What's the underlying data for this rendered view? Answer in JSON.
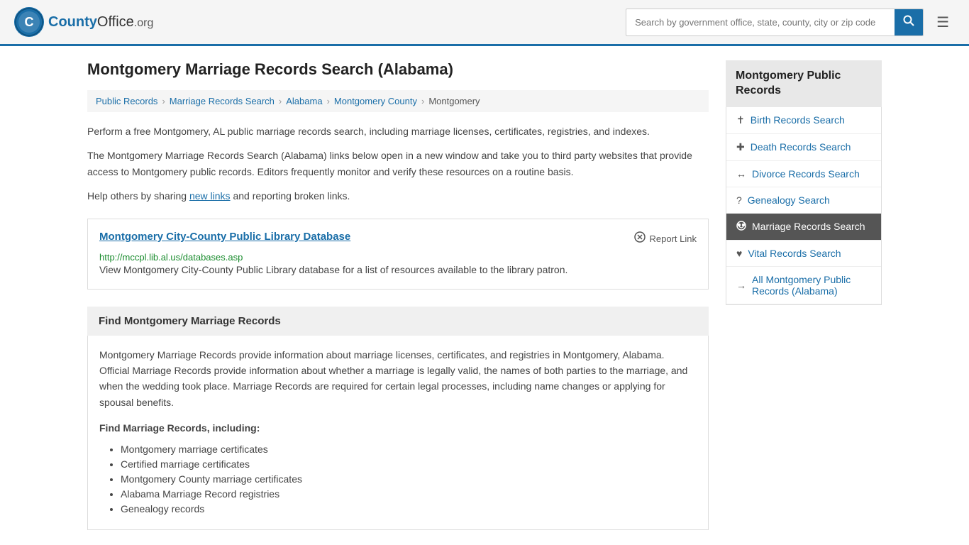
{
  "header": {
    "logo_text": "County",
    "logo_org": "Office",
    "logo_domain": ".org",
    "search_placeholder": "Search by government office, state, county, city or zip code",
    "menu_icon": "☰"
  },
  "page": {
    "title": "Montgomery Marriage Records Search (Alabama)",
    "breadcrumb": [
      {
        "label": "Public Records",
        "href": "#"
      },
      {
        "label": "Marriage Records Search",
        "href": "#"
      },
      {
        "label": "Alabama",
        "href": "#"
      },
      {
        "label": "Montgomery County",
        "href": "#"
      },
      {
        "label": "Montgomery",
        "href": "#"
      }
    ],
    "intro_1": "Perform a free Montgomery, AL public marriage records search, including marriage licenses, certificates, registries, and indexes.",
    "intro_2": "The Montgomery Marriage Records Search (Alabama) links below open in a new window and take you to third party websites that provide access to Montgomery public records. Editors frequently monitor and verify these resources on a routine basis.",
    "intro_3_prefix": "Help others by sharing ",
    "intro_3_link": "new links",
    "intro_3_suffix": " and reporting broken links.",
    "resource": {
      "title": "Montgomery City-County Public Library Database",
      "url": "http://mccpl.lib.al.us/databases.asp",
      "description": "View Montgomery City-County Public Library database for a list of resources available to the library patron.",
      "report_label": "Report Link",
      "report_icon": "⚙"
    },
    "find_section": {
      "title": "Find Montgomery Marriage Records",
      "body": "Montgomery Marriage Records provide information about marriage licenses, certificates, and registries in Montgomery, Alabama. Official Marriage Records provide information about whether a marriage is legally valid, the names of both parties to the marriage, and when the wedding took place. Marriage Records are required for certain legal processes, including name changes or applying for spousal benefits.",
      "list_header": "Find Marriage Records, including:",
      "list_items": [
        "Montgomery marriage certificates",
        "Certified marriage certificates",
        "Montgomery County marriage certificates",
        "Alabama Marriage Record registries",
        "Genealogy records"
      ]
    }
  },
  "sidebar": {
    "title": "Montgomery Public Records",
    "items": [
      {
        "label": "Birth Records Search",
        "icon": "✝",
        "active": false,
        "icon_name": "birth-icon"
      },
      {
        "label": "Death Records Search",
        "icon": "+",
        "active": false,
        "icon_name": "death-icon"
      },
      {
        "label": "Divorce Records Search",
        "icon": "↔",
        "active": false,
        "icon_name": "divorce-icon"
      },
      {
        "label": "Genealogy Search",
        "icon": "?",
        "active": false,
        "icon_name": "genealogy-icon"
      },
      {
        "label": "Marriage Records Search",
        "icon": "⚙",
        "active": true,
        "icon_name": "marriage-icon"
      },
      {
        "label": "Vital Records Search",
        "icon": "♥",
        "active": false,
        "icon_name": "vital-icon"
      }
    ],
    "all_records_label": "All Montgomery Public Records (Alabama)",
    "all_records_icon": "→"
  }
}
